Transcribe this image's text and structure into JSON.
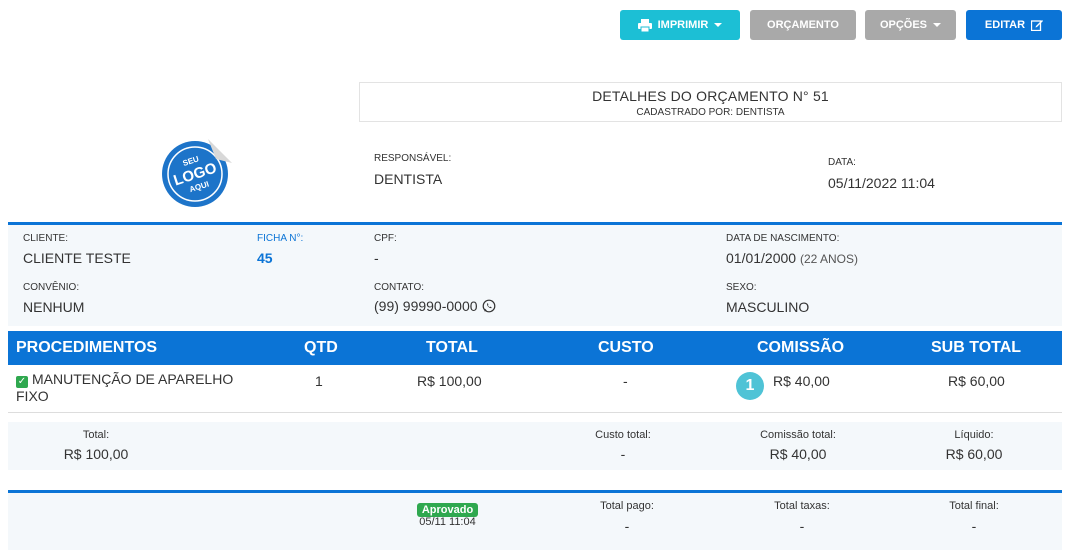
{
  "toolbar": {
    "print_label": "IMPRIMIR",
    "quote_label": "ORÇAMENTO",
    "options_label": "OPÇÕES",
    "edit_label": "EDITAR"
  },
  "header": {
    "title": "DETALHES DO ORÇAMENTO N° 51",
    "subtitle": "CADASTRADO POR: DENTISTA"
  },
  "logo": {
    "text_top": "SEU",
    "text_main": "LOGO",
    "text_bottom": "AQUI"
  },
  "responsible": {
    "label": "RESPONSÁVEL:",
    "value": "DENTISTA"
  },
  "date": {
    "label": "DATA:",
    "value": "05/11/2022 11:04"
  },
  "client": {
    "client_label": "CLIENTE:",
    "client_value": "CLIENTE TESTE",
    "file_label": "FICHA N°:",
    "file_value": "45",
    "cpf_label": "CPF:",
    "cpf_value": "-",
    "birth_label": "DATA DE NASCIMENTO:",
    "birth_value": "01/01/2000",
    "age": "(22 ANOS)",
    "insurance_label": "CONVÊNIO:",
    "insurance_value": "NENHUM",
    "contact_label": "CONTATO:",
    "contact_value": "(99) 99990-0000",
    "sex_label": "SEXO:",
    "sex_value": "MASCULINO"
  },
  "table": {
    "headers": [
      "PROCEDIMENTOS",
      "QTD",
      "TOTAL",
      "CUSTO",
      "COMISSÃO",
      "SUB TOTAL"
    ],
    "rows": [
      {
        "procedure": "MANUTENÇÃO DE APARELHO FIXO",
        "qty": "1",
        "total": "R$ 100,00",
        "cost": "-",
        "commission_badge": "1",
        "commission": "R$ 40,00",
        "subtotal": "R$ 60,00"
      }
    ]
  },
  "totals": {
    "total_label": "Total:",
    "total_value": "R$ 100,00",
    "cost_label": "Custo total:",
    "cost_value": "-",
    "commission_label": "Comissão total:",
    "commission_value": "R$ 40,00",
    "net_label": "Líquido:",
    "net_value": "R$ 60,00"
  },
  "footer": {
    "status": "Aprovado",
    "status_date": "05/11 11:04",
    "paid_label": "Total pago:",
    "paid_value": "-",
    "fees_label": "Total taxas:",
    "fees_value": "-",
    "final_label": "Total final:",
    "final_value": "-"
  },
  "colors": {
    "primary": "#0b74d6",
    "print": "#1cbfd5",
    "secondary": "#a9a9a9",
    "success": "#2fa84f",
    "badge": "#4fc3d6"
  }
}
